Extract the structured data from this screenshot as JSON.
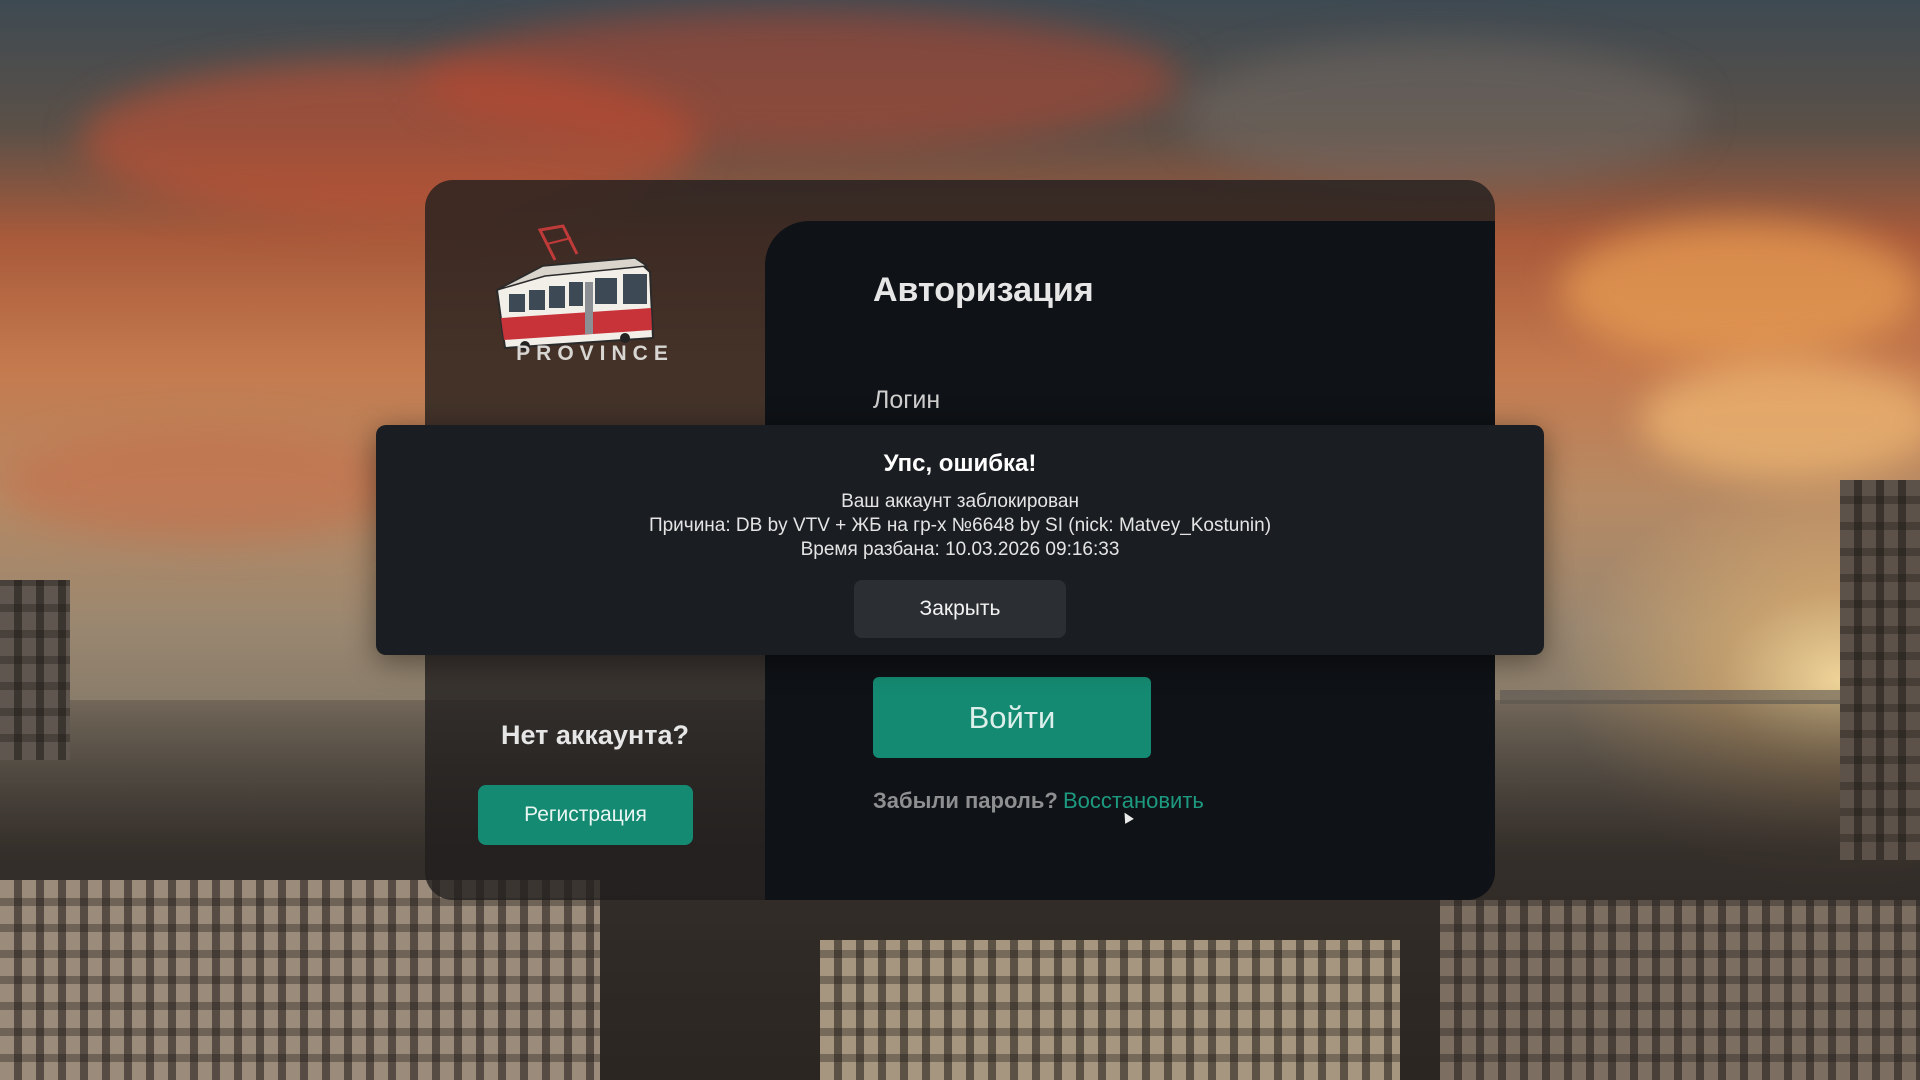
{
  "background": {
    "description_icon": "city-sunset-background"
  },
  "brand": {
    "name": "PROVINCE",
    "logo_icon": "tram-icon",
    "colors": {
      "accent": "#158a72",
      "panel": "#0f1216",
      "modal": "#1a1d22"
    }
  },
  "left_panel": {
    "no_account_text": "Нет аккаунта?",
    "register_label": "Регистрация"
  },
  "auth": {
    "title": "Авторизация",
    "login_label": "Логин",
    "submit_label": "Войти",
    "forgot_text": "Забыли пароль?",
    "restore_label": "Восстановить"
  },
  "error_modal": {
    "title": "Упс, ошибка!",
    "lines": [
      "Ваш аккаунт заблокирован",
      "Причина: DB by VTV + ЖБ на гр-х №6648 by SI (nick: Matvey_Kostunin)",
      "Время разбана: 10.03.2026 09:16:33"
    ],
    "close_label": "Закрыть"
  }
}
